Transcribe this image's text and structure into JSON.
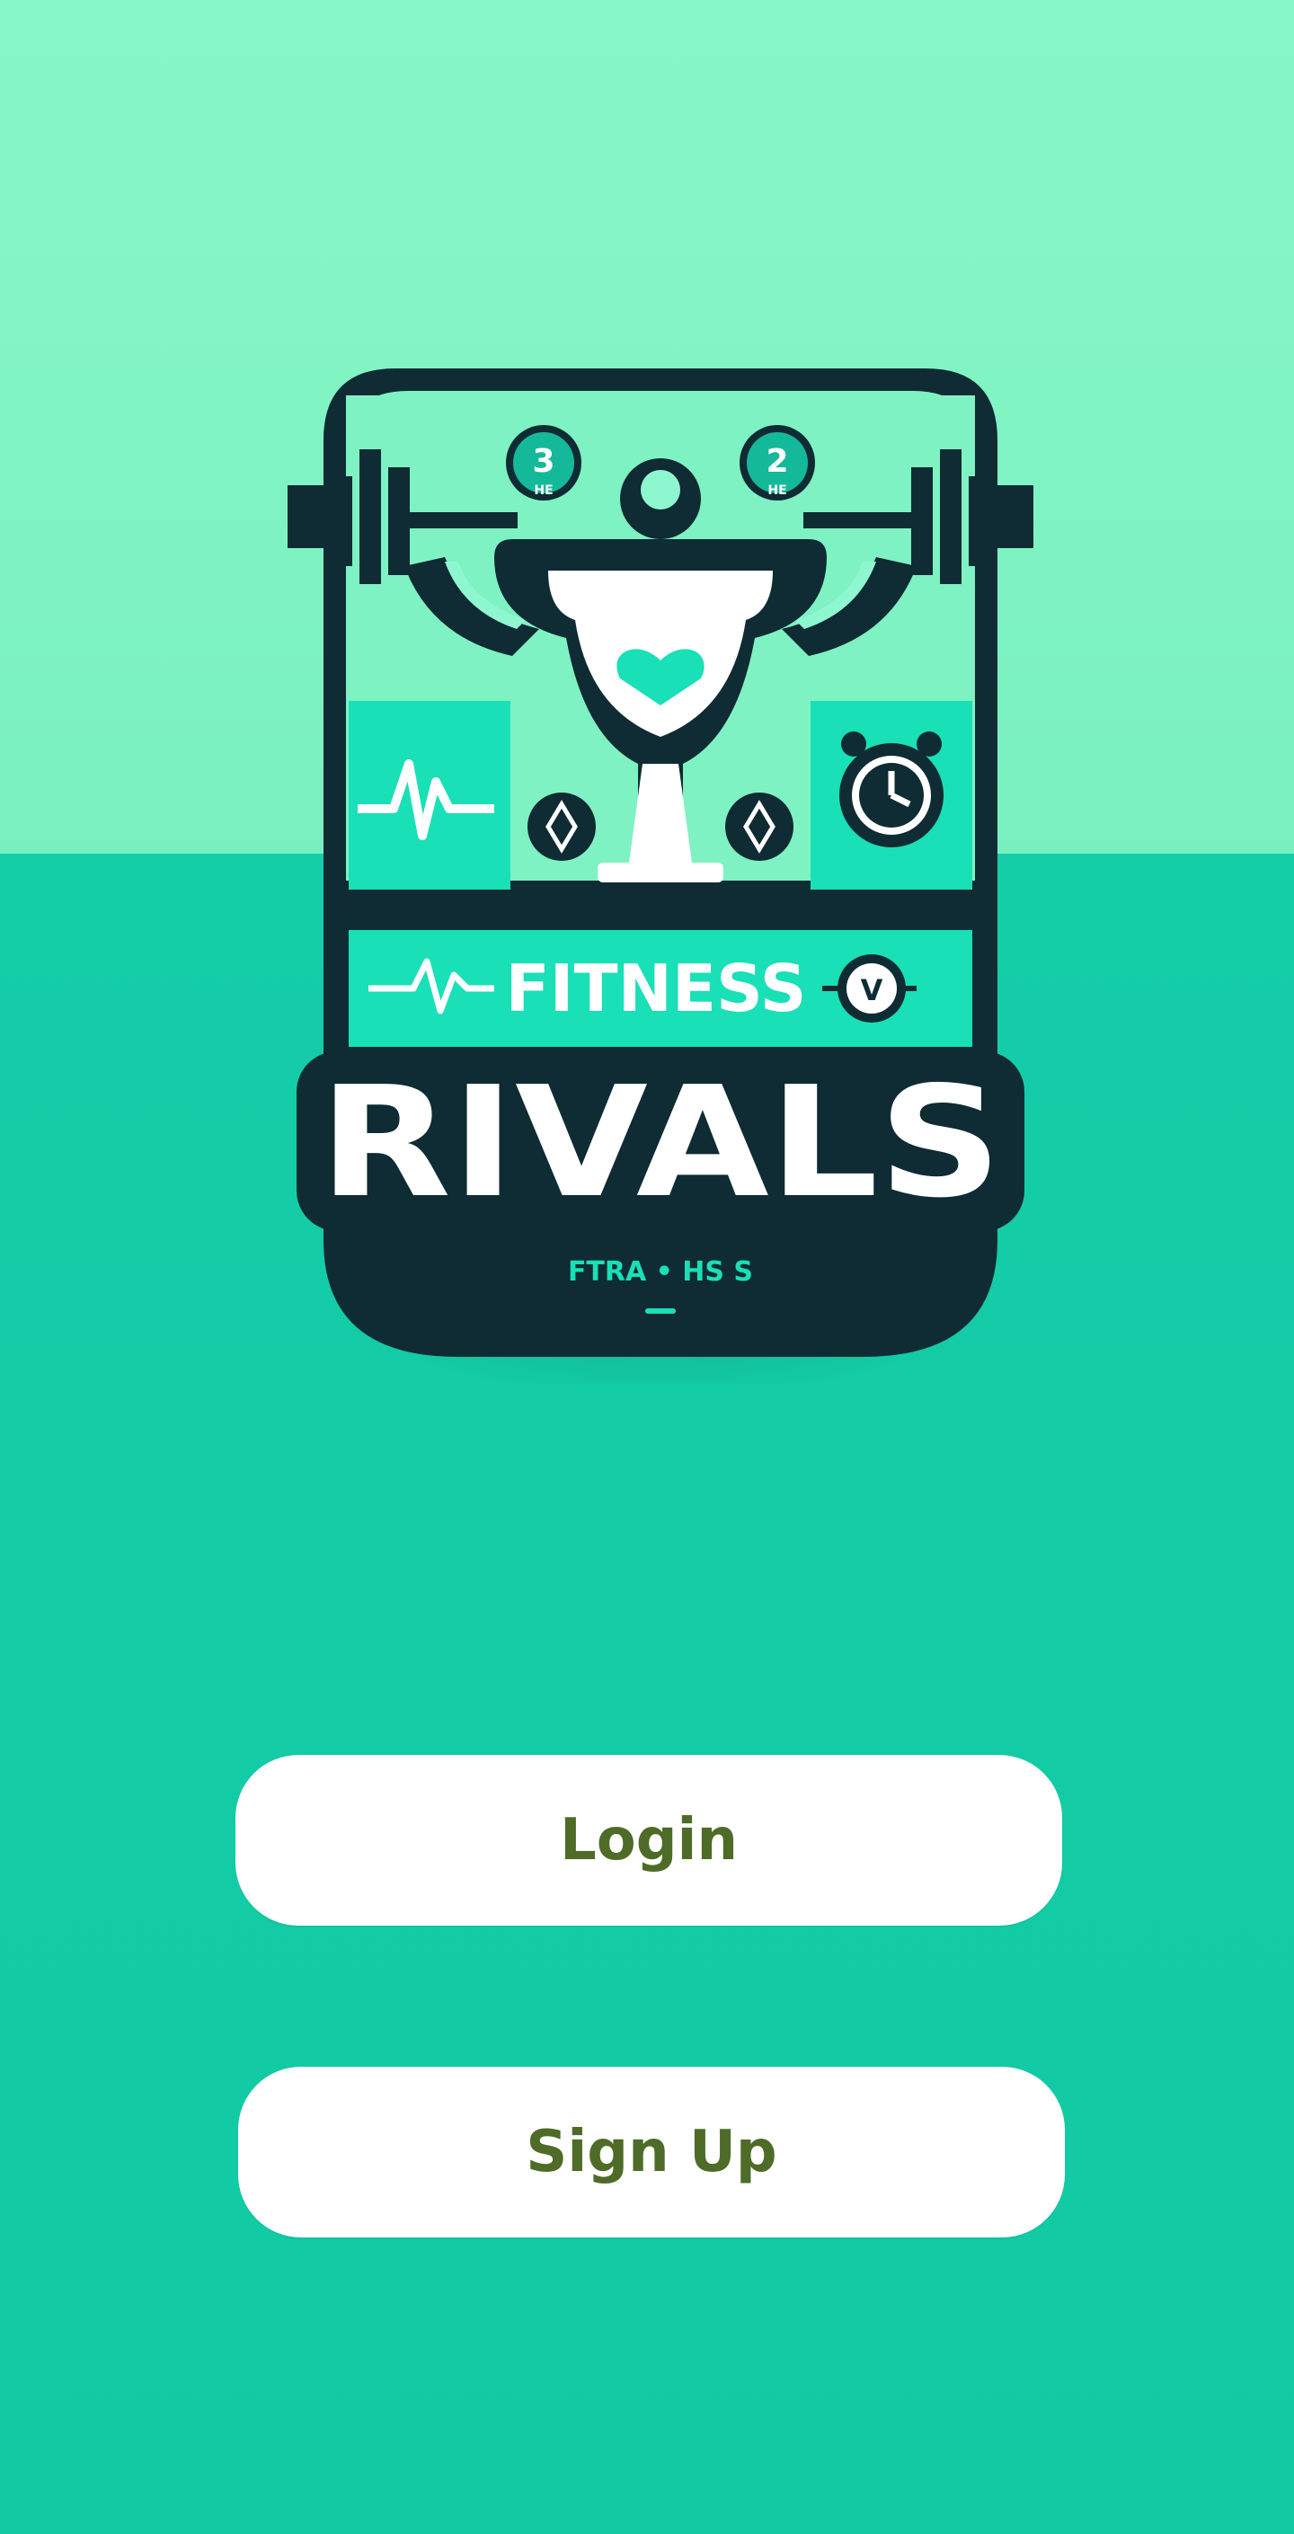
{
  "app": {
    "logo": {
      "top_word": "FITNESS",
      "main_word": "RIVALS",
      "tagline": "FTRA • HS S",
      "badge_left_number": "3",
      "badge_left_sub": "HE",
      "badge_right_number": "2",
      "badge_right_sub": "HE"
    }
  },
  "actions": {
    "login_label": "Login",
    "signup_label": "Sign Up"
  },
  "colors": {
    "top_background": "#81f4c4",
    "bottom_background": "#14cca7",
    "logo_dark": "#0f2b33",
    "logo_accent": "#19e0b6",
    "button_background": "#ffffff",
    "button_text": "#4e6b28"
  }
}
